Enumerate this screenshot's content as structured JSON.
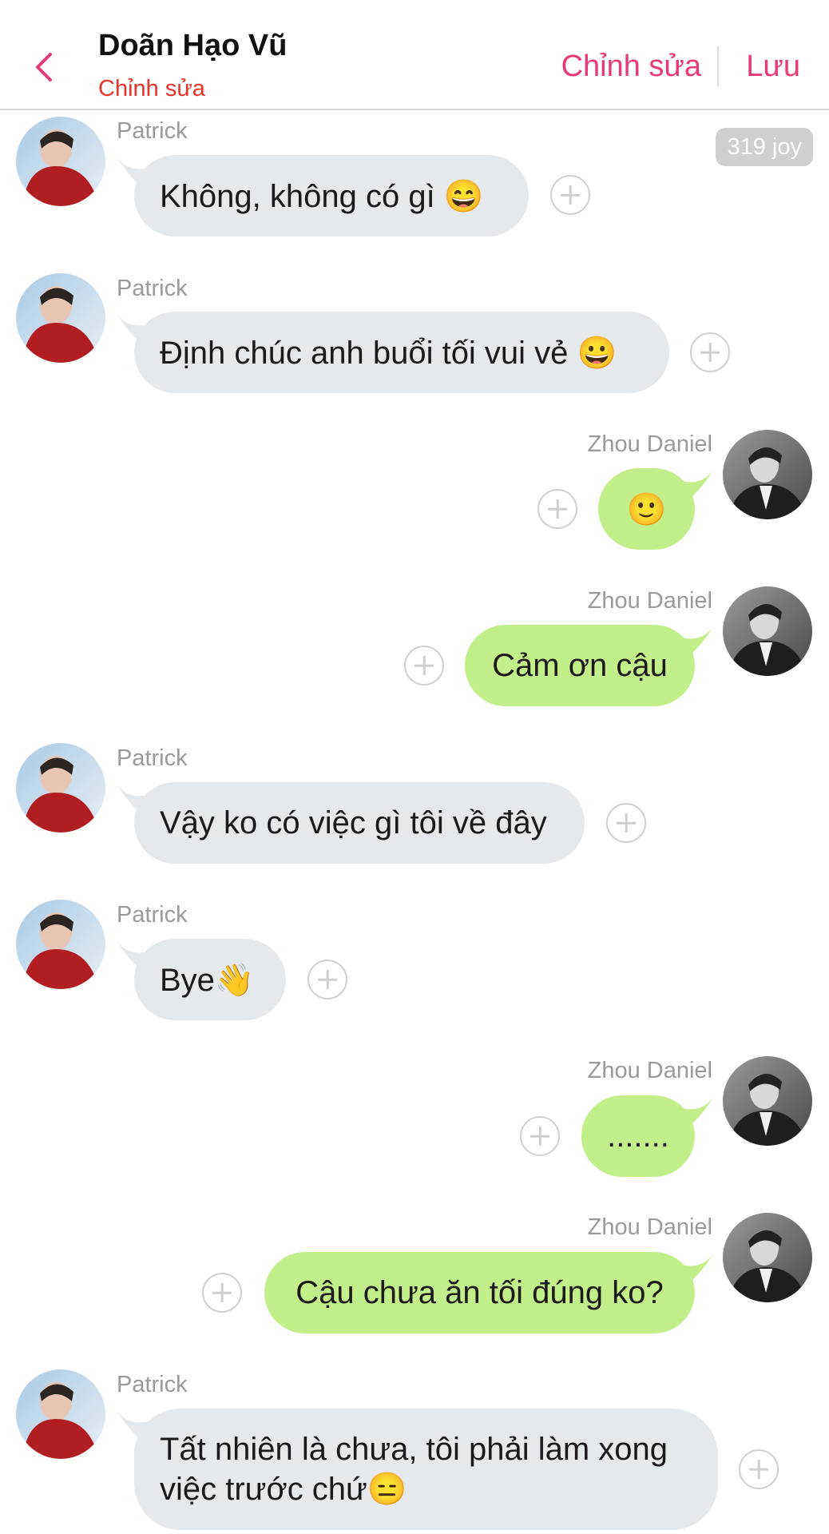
{
  "header": {
    "title": "Doãn Hạo Vũ",
    "subtitle": "Chỉnh sửa",
    "edit_label": "Chỉnh sửa",
    "save_label": "Lưu"
  },
  "badge": {
    "text": "319 joy"
  },
  "messages": [
    {
      "sender": "Patrick",
      "text": "Không, không có gì 😄",
      "side": "left"
    },
    {
      "sender": "Patrick",
      "text": "Định chúc anh buổi tối vui vẻ 😀",
      "side": "left"
    },
    {
      "sender": "Zhou Daniel",
      "text": "🙂",
      "side": "right"
    },
    {
      "sender": "Zhou Daniel",
      "text": "Cảm ơn cậu",
      "side": "right"
    },
    {
      "sender": "Patrick",
      "text": "Vậy ko có việc gì tôi về đây",
      "side": "left"
    },
    {
      "sender": "Patrick",
      "text": "Bye👋",
      "side": "left"
    },
    {
      "sender": "Zhou Daniel",
      "text": ".......",
      "side": "right"
    },
    {
      "sender": "Zhou Daniel",
      "text": "Cậu chưa ăn tối đúng ko?",
      "side": "right"
    },
    {
      "sender": "Patrick",
      "text": "Tất nhiên là chưa, tôi phải làm xong việc trước chứ😑",
      "side": "left"
    }
  ],
  "colors": {
    "accent": "#e83a78",
    "subtitle": "#e8322b",
    "bubble_left": "#e6e9ec",
    "bubble_right": "#c3ef8b"
  }
}
